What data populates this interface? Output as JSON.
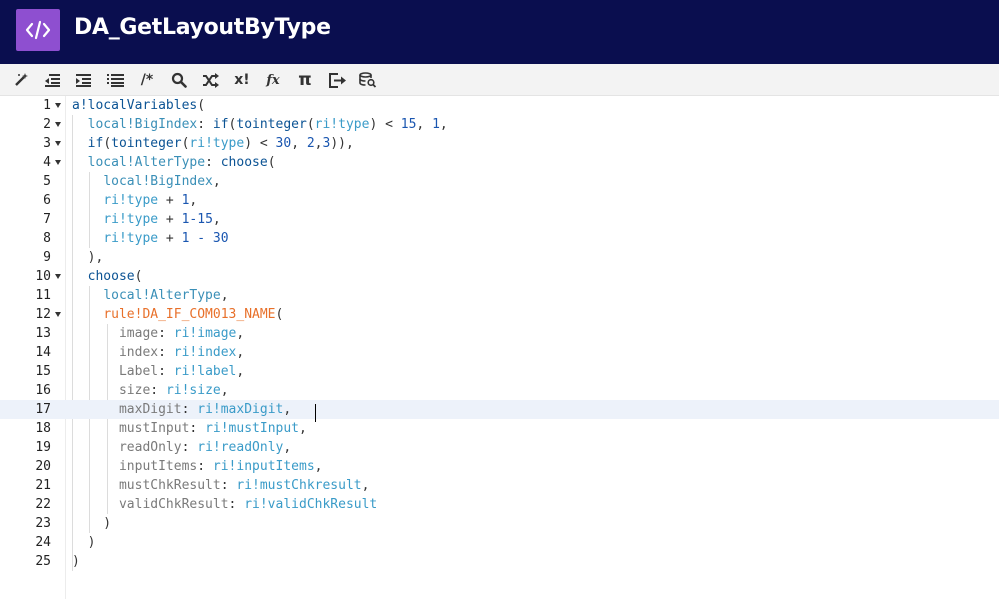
{
  "header": {
    "title": "DA_GetLayoutByType",
    "icon": "code-brackets-icon",
    "background": "#0a0e4f",
    "icon_background": "#8e4fd0"
  },
  "toolbar": {
    "tools": [
      {
        "name": "magic-wand-icon"
      },
      {
        "name": "outdent-icon"
      },
      {
        "name": "indent-icon"
      },
      {
        "name": "format-list-icon"
      },
      {
        "name": "comment-icon",
        "text": "/*"
      },
      {
        "name": "search-icon"
      },
      {
        "name": "shuffle-icon"
      },
      {
        "name": "variable-icon",
        "text": "x!"
      },
      {
        "name": "function-icon",
        "text": "fx"
      },
      {
        "name": "pi-icon",
        "text": "π"
      },
      {
        "name": "export-icon"
      },
      {
        "name": "data-search-icon"
      }
    ]
  },
  "editor": {
    "cursor_line": 17,
    "lines": [
      {
        "n": "1",
        "fold": true
      },
      {
        "n": "2",
        "fold": true
      },
      {
        "n": "3",
        "fold": true
      },
      {
        "n": "4",
        "fold": true
      },
      {
        "n": "5",
        "fold": false
      },
      {
        "n": "6",
        "fold": false
      },
      {
        "n": "7",
        "fold": false
      },
      {
        "n": "8",
        "fold": false
      },
      {
        "n": "9",
        "fold": false
      },
      {
        "n": "10",
        "fold": true
      },
      {
        "n": "11",
        "fold": false
      },
      {
        "n": "12",
        "fold": true
      },
      {
        "n": "13",
        "fold": false
      },
      {
        "n": "14",
        "fold": false
      },
      {
        "n": "15",
        "fold": false
      },
      {
        "n": "16",
        "fold": false
      },
      {
        "n": "17",
        "fold": false
      },
      {
        "n": "18",
        "fold": false
      },
      {
        "n": "19",
        "fold": false
      },
      {
        "n": "20",
        "fold": false
      },
      {
        "n": "21",
        "fold": false
      },
      {
        "n": "22",
        "fold": false
      },
      {
        "n": "23",
        "fold": false
      },
      {
        "n": "24",
        "fold": false
      },
      {
        "n": "25",
        "fold": false
      }
    ],
    "tokens": {
      "l1": [
        "a!localVariables",
        "("
      ],
      "l2": [
        "  ",
        "local!BigIndex",
        ": ",
        "if",
        "(",
        "tointeger",
        "(",
        "ri!type",
        ") < ",
        "15",
        ", ",
        "1",
        ","
      ],
      "l3": [
        "  ",
        "if",
        "(",
        "tointeger",
        "(",
        "ri!type",
        ") < ",
        "30",
        ", ",
        "2",
        ",",
        "3",
        ")),"
      ],
      "l4": [
        "  ",
        "local!AlterType",
        ": ",
        "choose",
        "("
      ],
      "l5": [
        "    ",
        "local!BigIndex",
        ","
      ],
      "l6": [
        "    ",
        "ri!type",
        " + ",
        "1",
        ","
      ],
      "l7": [
        "    ",
        "ri!type",
        " + ",
        "1-15",
        ","
      ],
      "l8": [
        "    ",
        "ri!type",
        " + ",
        "1 - 30"
      ],
      "l9": [
        "  ),"
      ],
      "l10": [
        "  ",
        "choose",
        "("
      ],
      "l11": [
        "    ",
        "local!AlterType",
        ","
      ],
      "l12": [
        "    ",
        "rule!DA_IF_COM013_NAME",
        "("
      ],
      "l13": [
        "      ",
        "image",
        ": ",
        "ri!image",
        ","
      ],
      "l14": [
        "      ",
        "index",
        ": ",
        "ri!index",
        ","
      ],
      "l15": [
        "      ",
        "Label",
        ": ",
        "ri!label",
        ","
      ],
      "l16": [
        "      ",
        "size",
        ": ",
        "ri!size",
        ","
      ],
      "l17": [
        "      ",
        "maxDigit",
        ": ",
        "ri!maxDigit",
        ","
      ],
      "l18": [
        "      ",
        "mustInput",
        ": ",
        "ri!mustInput",
        ","
      ],
      "l19": [
        "      ",
        "readOnly",
        ": ",
        "ri!readOnly",
        ","
      ],
      "l20": [
        "      ",
        "inputItems",
        ": ",
        "ri!inputItems",
        ","
      ],
      "l21": [
        "      ",
        "mustChkResult",
        ": ",
        "ri!mustChkresult",
        ","
      ],
      "l22": [
        "      ",
        "validChkResult",
        ": ",
        "ri!validChkResult"
      ],
      "l23": [
        "    )"
      ],
      "l24": [
        "  )"
      ],
      "l25": [
        ")"
      ]
    }
  }
}
